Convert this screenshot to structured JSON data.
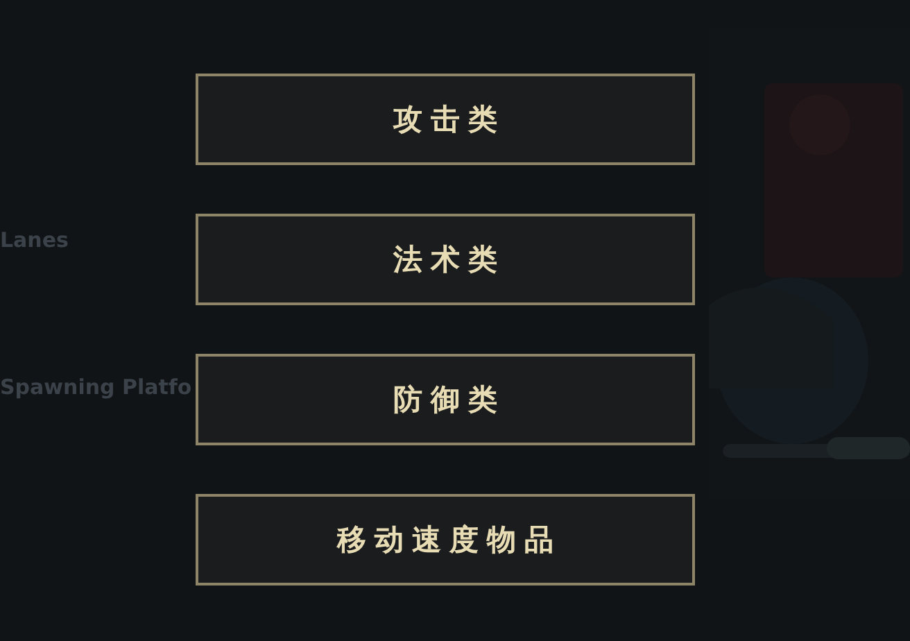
{
  "background": {
    "headings": [
      "Lanes",
      "Spawning Platfo"
    ]
  },
  "menu": {
    "buttons": [
      {
        "label": "攻击类"
      },
      {
        "label": "法术类"
      },
      {
        "label": "防御类"
      },
      {
        "label": "移动速度物品"
      }
    ]
  }
}
